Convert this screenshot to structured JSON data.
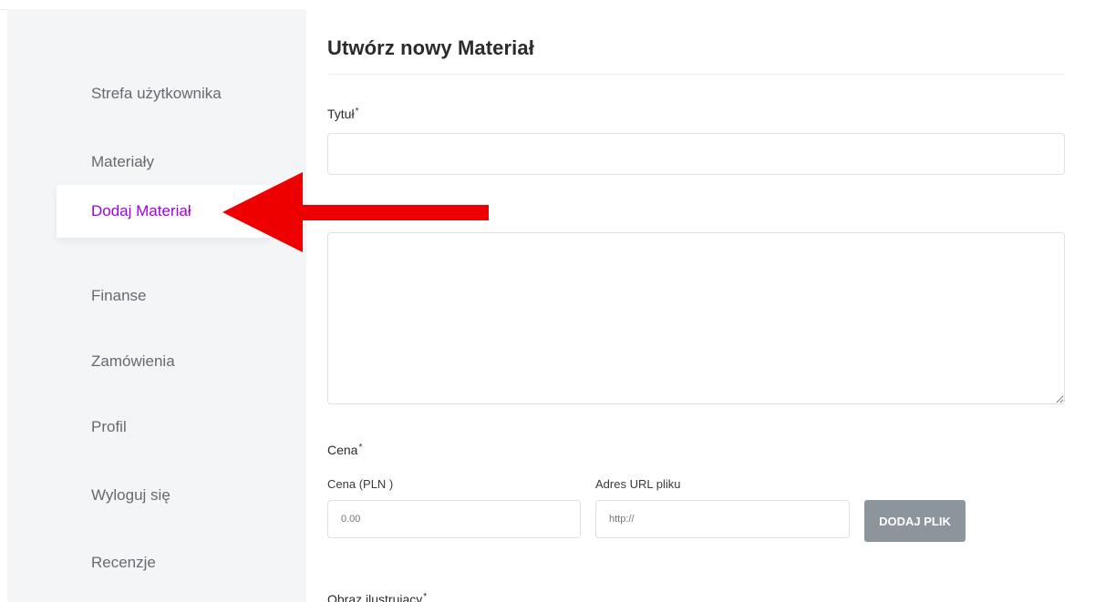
{
  "sidebar": {
    "items": [
      {
        "label": "Strefa użytkownika",
        "active": false
      },
      {
        "label": "Materiały",
        "active": false
      },
      {
        "label": "Dodaj Materiał",
        "active": true
      },
      {
        "label": "Finanse",
        "active": false
      },
      {
        "label": "Zamówienia",
        "active": false
      },
      {
        "label": "Profil",
        "active": false
      },
      {
        "label": "Wyloguj się",
        "active": false
      },
      {
        "label": "Recenzje",
        "active": false
      }
    ]
  },
  "main": {
    "title": "Utwórz nowy Materiał",
    "title_field": {
      "label": "Tytuł",
      "required_mark": "*",
      "value": ""
    },
    "description_field": {
      "value": ""
    },
    "price_section": {
      "label": "Cena",
      "required_mark": "*",
      "price_label": "Cena (PLN )",
      "price_placeholder": "0.00",
      "url_label": "Adres URL pliku",
      "url_placeholder": "http://",
      "upload_button": "DODAJ PLIK"
    },
    "image_field": {
      "label": "Obraz ilustrujący",
      "required_mark": "*"
    }
  },
  "colors": {
    "accent": "#a100e0",
    "annotation_arrow": "#ee0000",
    "button": "#8c949c",
    "sidebar_bg": "#f4f5f7"
  }
}
